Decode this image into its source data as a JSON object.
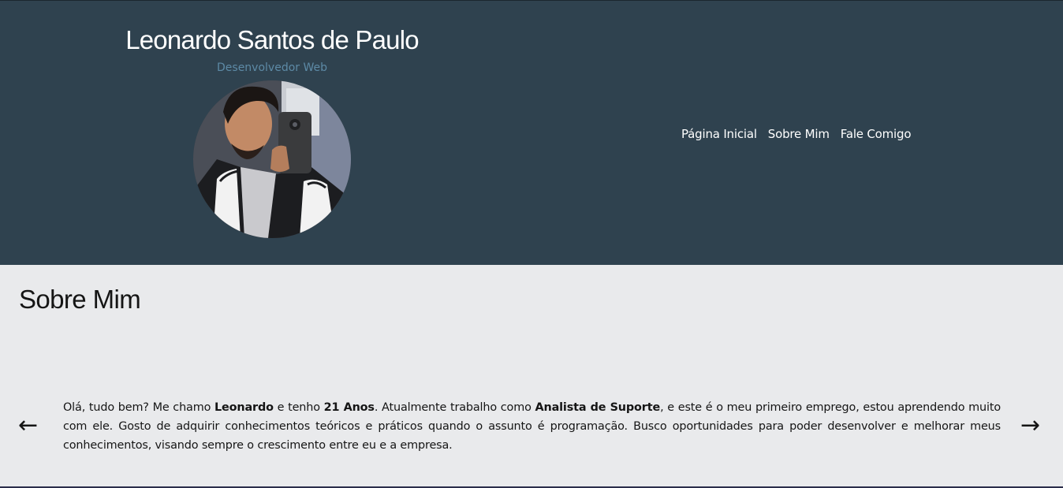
{
  "header": {
    "name": "Leonardo Santos de Paulo",
    "role": "Desenvolvedor Web",
    "avatar_alt": "profile-photo"
  },
  "nav": {
    "items": [
      {
        "label": "Página Inicial"
      },
      {
        "label": "Sobre Mim"
      },
      {
        "label": "Fale Comigo"
      }
    ]
  },
  "about": {
    "title": "Sobre Mim",
    "intro": "Olá, tudo bem? Me chamo ",
    "name": "Leonardo",
    "mid1": " e tenho ",
    "age": "21 Anos",
    "mid2": ". Atualmente trabalho como ",
    "job": "Analista de Suporte",
    "rest": ", e este é o meu primeiro emprego, estou aprendendo muito com ele. Gosto de adquirir conhecimentos teóricos e práticos quando o assunto é programação. Busco oportunidades para poder desenvolver e melhorar meus conhecimentos, visando sempre o crescimento entre eu e a empresa."
  },
  "carousel": {
    "prev_icon": "←",
    "next_icon": "→"
  },
  "colors": {
    "header_bg": "#2f424f",
    "page_bg": "#e9eaec",
    "role_text": "#5d8aa6"
  }
}
